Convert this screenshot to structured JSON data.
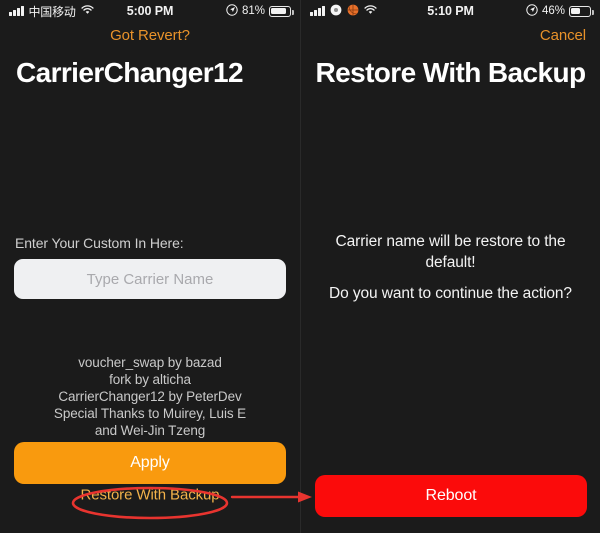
{
  "left_panel": {
    "status_bar": {
      "signal_icon": "signal-bars-icon",
      "carrier": "中国移动",
      "wifi_icon": "wifi-icon",
      "time": "5:00 PM",
      "location_icon": "location-arrow-icon",
      "battery_percent": "81%",
      "battery_icon": "battery-icon"
    },
    "nav": {
      "action_label": "Got Revert?"
    },
    "title": "CarrierChanger12",
    "form": {
      "label": "Enter Your Custom In Here:",
      "input_value": "",
      "input_placeholder": "Type Carrier Name"
    },
    "credits": [
      "voucher_swap by bazad",
      "fork by alticha",
      "CarrierChanger12 by PeterDev",
      "Special Thanks to Muirey, Luis E",
      "and Wei-Jin Tzeng"
    ],
    "apply_label": "Apply",
    "restore_link_label": "Restore With Backup"
  },
  "right_panel": {
    "status_bar": {
      "signal_icon": "signal-bars-icon",
      "badge_icon_white": "white-circle-icon",
      "badge_icon_orange": "basketball-icon",
      "wifi_icon": "wifi-icon",
      "time": "5:10 PM",
      "location_icon": "location-arrow-icon",
      "battery_percent": "46%",
      "battery_icon": "battery-icon"
    },
    "nav": {
      "action_label": "Cancel"
    },
    "title": "Restore With Backup",
    "message_line_1": "Carrier name will be restore to the default!",
    "message_line_2": "Do you want to continue the action?",
    "reboot_label": "Reboot"
  },
  "annotations": {
    "highlight_ellipse": "red-ellipse-around-restore-link",
    "arrow": "red-arrow-pointing-right"
  },
  "colors": {
    "background": "#1b1b1b",
    "accent_orange": "#e8922a",
    "apply_orange": "#f99a0e",
    "reboot_red": "#fb0b0b",
    "annotation_red": "#e8342f",
    "input_background": "#eff0f2"
  }
}
